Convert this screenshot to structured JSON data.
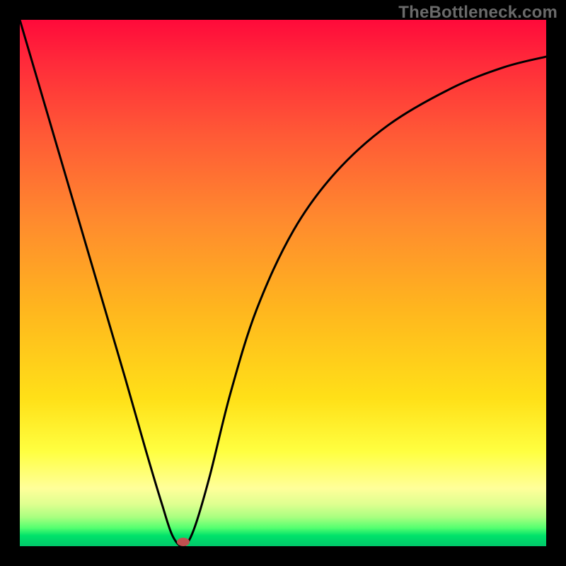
{
  "watermark": "TheBottleneck.com",
  "chart_data": {
    "type": "line",
    "title": "",
    "xlabel": "",
    "ylabel": "",
    "x_range": [
      0,
      1
    ],
    "y_range": [
      0,
      1
    ],
    "series": [
      {
        "name": "bottleneck-curve",
        "x": [
          0.0,
          0.05,
          0.1,
          0.15,
          0.2,
          0.24,
          0.27,
          0.29,
          0.31,
          0.33,
          0.36,
          0.4,
          0.45,
          0.52,
          0.6,
          0.7,
          0.82,
          0.92,
          1.0
        ],
        "y": [
          1.0,
          0.83,
          0.66,
          0.49,
          0.32,
          0.18,
          0.08,
          0.02,
          0.0,
          0.03,
          0.13,
          0.29,
          0.45,
          0.6,
          0.71,
          0.8,
          0.87,
          0.91,
          0.93
        ]
      }
    ],
    "marker": {
      "x": 0.31,
      "y": 0.0,
      "color": "#c05050"
    },
    "gradient_colors": {
      "top": "#ff0a3a",
      "mid": "#ffe018",
      "bottom": "#00c86a"
    }
  }
}
